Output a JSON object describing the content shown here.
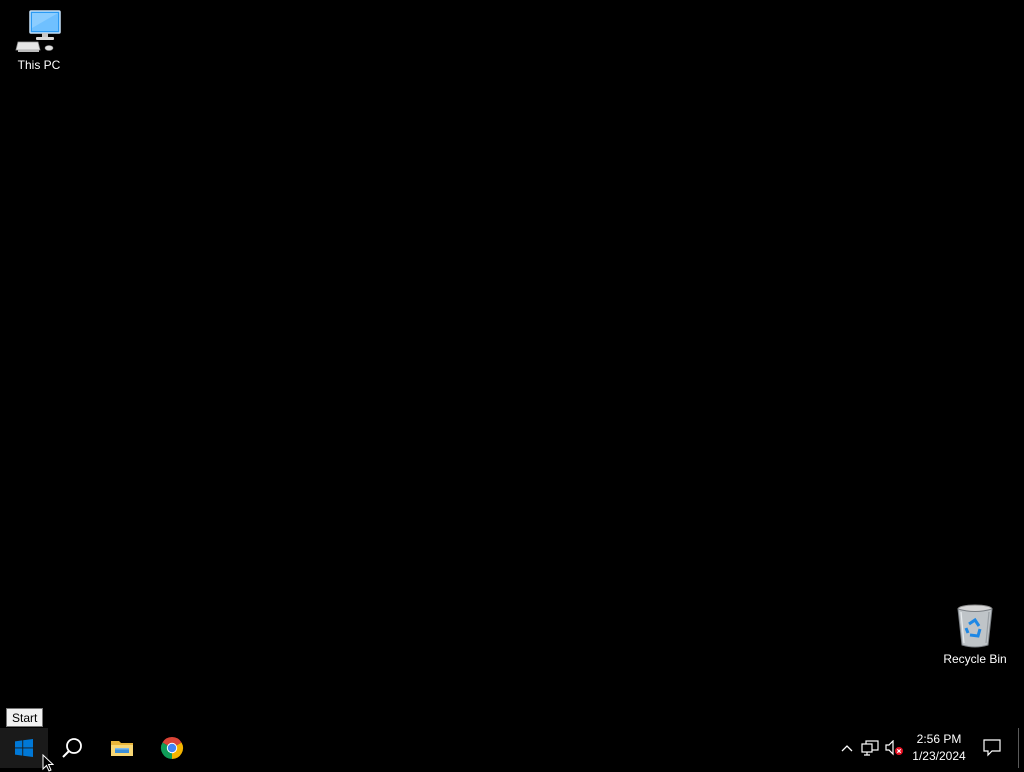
{
  "desktop": {
    "icons": [
      {
        "label": "This PC",
        "icon": "computer-icon"
      },
      {
        "label": "Recycle Bin",
        "icon": "recycle-bin-icon"
      }
    ]
  },
  "tooltip": {
    "text": "Start"
  },
  "taskbar": {
    "buttons": [
      {
        "name": "Start",
        "icon": "windows-logo-icon"
      },
      {
        "name": "Search",
        "icon": "search-icon"
      },
      {
        "name": "File Explorer",
        "icon": "folder-icon"
      },
      {
        "name": "Google Chrome",
        "icon": "chrome-icon"
      }
    ],
    "tray": {
      "icons": [
        "chevron-up-icon",
        "network-icon",
        "volume-muted-icon"
      ],
      "time": "2:56 PM",
      "date": "1/23/2024"
    }
  },
  "colors": {
    "background": "#000000",
    "windows_blue": "#0078d7",
    "muted_badge": "#e81123"
  }
}
